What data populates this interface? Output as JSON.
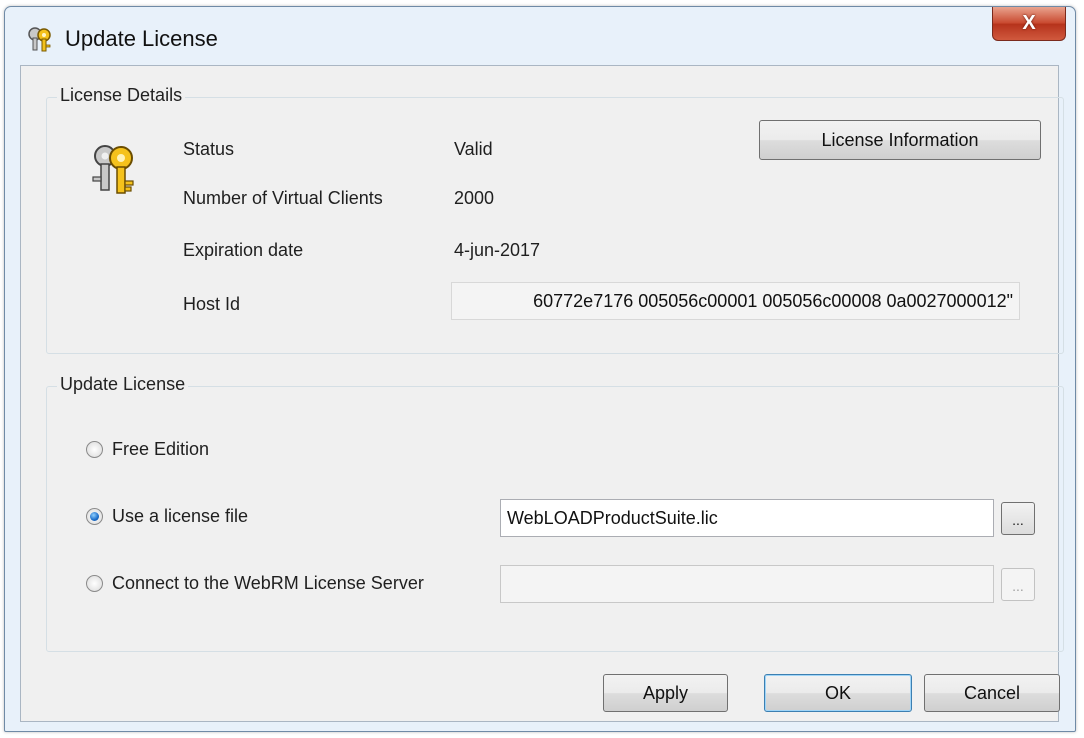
{
  "window": {
    "title": "Update License",
    "close_label": "X"
  },
  "details": {
    "legend": "License Details",
    "status_label": "Status",
    "status_value": "Valid",
    "clients_label": "Number of Virtual Clients",
    "clients_value": "2000",
    "expiration_label": "Expiration date",
    "expiration_value": "4-jun-2017",
    "hostid_label": "Host Id",
    "hostid_value": "60772e7176 005056c00001 005056c00008 0a0027000012\"",
    "info_button": "License Information"
  },
  "update": {
    "legend": "Update License",
    "free_label": "Free Edition",
    "file_label": "Use a license file",
    "file_value": "WebLOADProductSuite.lic",
    "server_label": "Connect to the WebRM License Server",
    "server_value": "",
    "browse_label": "...",
    "selected_option": "Use a license file"
  },
  "footer": {
    "apply": "Apply",
    "ok": "OK",
    "cancel": "Cancel"
  },
  "icons": {
    "title": "keys-icon",
    "details": "keys-icon"
  }
}
